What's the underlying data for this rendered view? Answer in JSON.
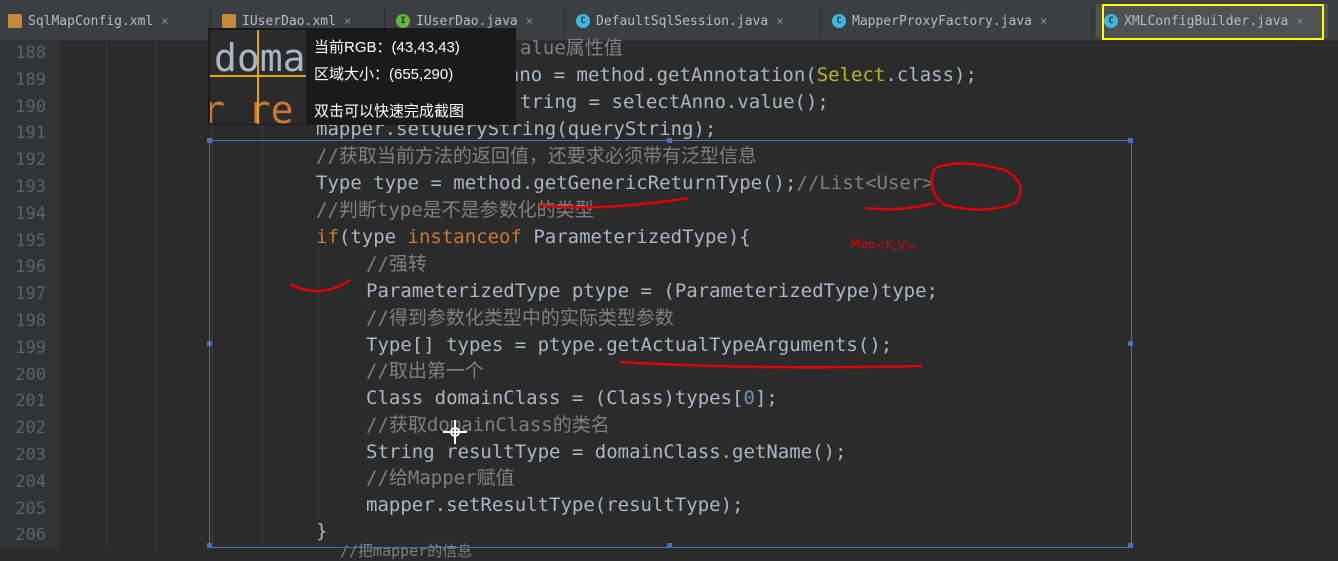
{
  "tabs": [
    {
      "label": "SqlMapConfig.xml",
      "icon": "xml-file-icon",
      "active": false
    },
    {
      "label": "IUserDao.xml",
      "icon": "xml-file-icon",
      "active": false
    },
    {
      "label": "IUserDao.java",
      "icon": "interface-icon",
      "active": false
    },
    {
      "label": "DefaultSqlSession.java",
      "icon": "class-icon",
      "active": false
    },
    {
      "label": "MapperProxyFactory.java",
      "icon": "class-icon",
      "active": false
    },
    {
      "label": "XMLConfigBuilder.java",
      "icon": "class-icon",
      "active": true
    }
  ],
  "close_glyph": "×",
  "line_numbers": [
    "188",
    "189",
    "190",
    "191",
    "192",
    "193",
    "194",
    "195",
    "196",
    "197",
    "198",
    "199",
    "200",
    "201",
    "202",
    "203",
    "204",
    "205",
    "206"
  ],
  "code": {
    "l188": "alue属性值",
    "l189_a": "tAnno = method.getAnnotation(",
    "l189_b": "Select",
    "l189_c": ".class);",
    "l190": "tring = selectAnno.value();",
    "l191": "mapper.setQueryString(queryString);",
    "l192": "//获取当前方法的返回值，还要求必须带有泛型信息",
    "l193_a": "Type type = method.getGenericReturnType();",
    "l193_b": "//List<User>",
    "l194": "//判断type是不是参数化的类型",
    "l195_a": "if",
    "l195_b": "(type ",
    "l195_c": "instanceof",
    "l195_d": " ParameterizedType){",
    "l196": "//强转",
    "l197": "ParameterizedType ptype = (ParameterizedType)type;",
    "l198": "//得到参数化类型中的实际类型参数",
    "l199": "Type[] types = ptype.getActualTypeArguments();",
    "l200": "//取出第一个",
    "l201_a": "Class domainClass = (Class)types[",
    "l201_b": "0",
    "l201_c": "];",
    "l202": "//获取domainClass的类名",
    "l203": "String resultType = domainClass.getName();",
    "l204": "//给Mapper赋值",
    "l205": "mapper.setResultType(resultType);",
    "l206": "}",
    "l207": "//把mapper的信息"
  },
  "tooltip": {
    "rgb": "当前RGB：(43,43,43)",
    "size": "区域大小：(655,290)",
    "hint": "双击可以快速完成截图",
    "magnified_text": "doma",
    "magnified_text2": "r re"
  },
  "annotation_handwriting": "Map<K,V>",
  "colors": {
    "editor_bg": "#2b2b2b",
    "keyword": "#cc7832",
    "comment": "#808080",
    "annotation_red": "#e0000a",
    "highlight_yellow": "#ffff00",
    "selection_blue": "#4a6fbf"
  }
}
